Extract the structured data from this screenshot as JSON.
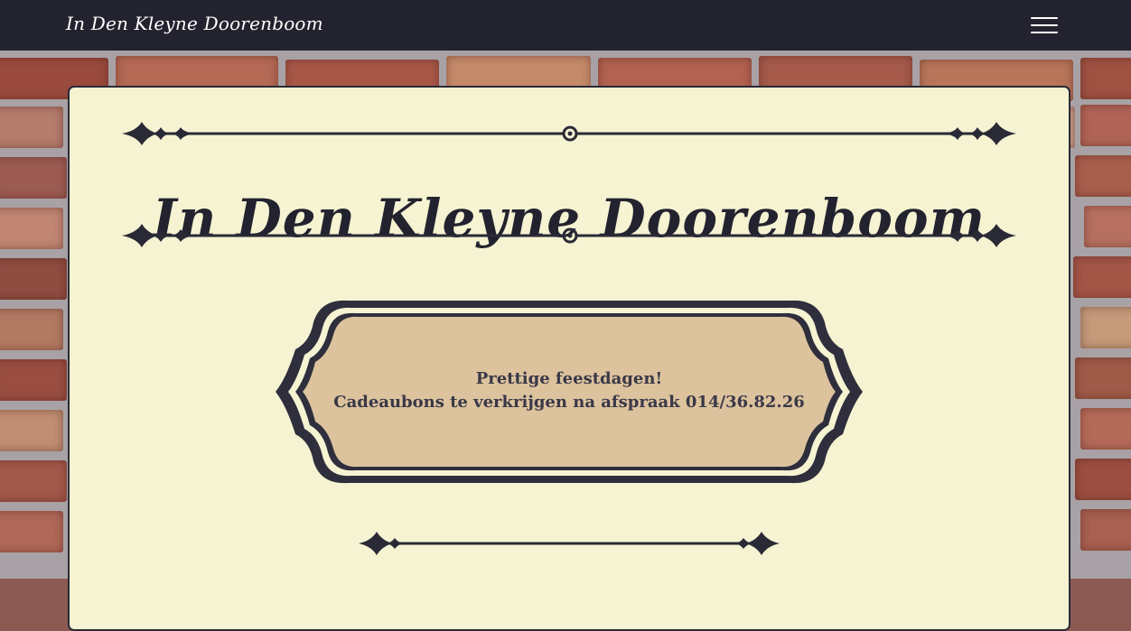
{
  "navbar": {
    "brand": "In Den Kleyne Doorenboom",
    "menu_icon": "hamburger-menu-icon"
  },
  "main": {
    "title": "In Den Kleyne Doorenboom",
    "announcement": {
      "line1": "Prettige feestdagen!",
      "line2": "Cadeaubons te verkrijgen na afspraak 014/36.82.26"
    }
  },
  "colors": {
    "navbar_bg": "#23232f",
    "card_bg": "#f5f3d2",
    "plaque_fill": "#dcc39d",
    "ornament": "#2a2a36",
    "text": "#3a3848"
  }
}
